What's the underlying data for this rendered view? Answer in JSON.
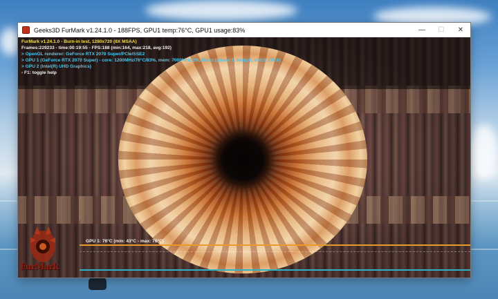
{
  "window": {
    "title": "Geeks3D FurMark v1.24.1.0 - 188FPS, GPU1 temp:76°C, GPU1 usage:83%",
    "controls": [
      "—",
      "☐",
      "✕"
    ]
  },
  "osd": {
    "line1": "FurMark v1.24.1.0 - Burn-in test, 1280x720 (8X MSAA)",
    "line2": "Frames:229233 - time:00:19:55 - FPS:188 (min:164, max:218, avg:192)",
    "line3": "> OpenGL renderer: GeForce RTX 2070 Super/PCIe/SSE2",
    "line4": "> GPU 1 (GeForce RTX 2070 Super) - core: 1200MHz/76°C/83%, mem: 7000MHz/2%, limits:[power:1, temp:0, volt:0, OV:0]",
    "line5": "> GPU 2 (Intel(R) UHD Graphics)",
    "line6": "- F1: toggle help"
  },
  "graph": {
    "label": "GPU 1: 76°C (min: 43°C - max: 76°C)",
    "current_c": 76,
    "min_c": 43,
    "max_c": 76
  },
  "logo": {
    "text": "FurMark"
  },
  "colors": {
    "osd_yellow": "#f4e04a",
    "osd_cyan": "#4fc8f0",
    "graph_line": "#e89a2a",
    "graph_axis_x": "#2fb3c8",
    "graph_axis_y": "#c82020"
  }
}
